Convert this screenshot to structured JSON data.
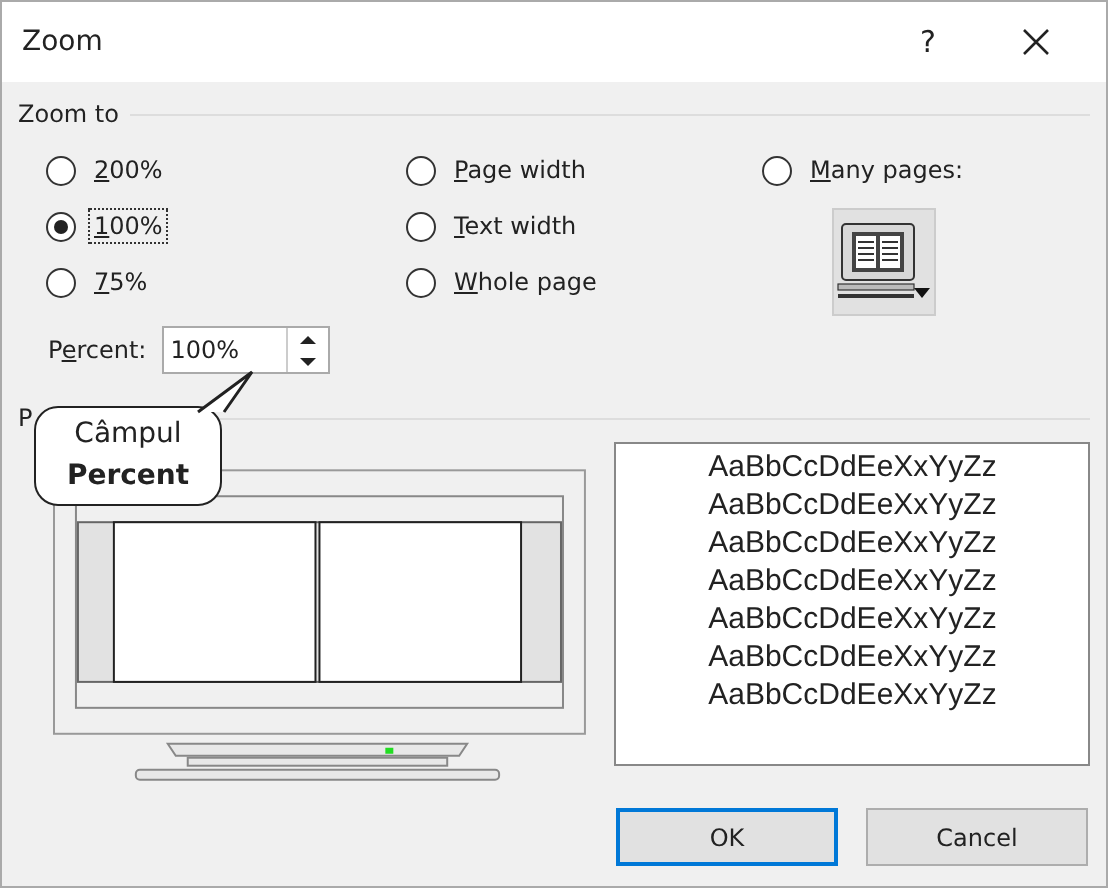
{
  "window": {
    "title": "Zoom",
    "help": "?"
  },
  "zoom_to": {
    "label": "Zoom to",
    "options": [
      {
        "key": "2",
        "post": "00%",
        "selected": false,
        "focused": false
      },
      {
        "key": "P",
        "post": "age width",
        "selected": false,
        "focused": false
      },
      {
        "key": "M",
        "post": "any pages:",
        "selected": false,
        "focused": false
      },
      {
        "key": "1",
        "post": "00%",
        "selected": true,
        "focused": true
      },
      {
        "key": "T",
        "post": "ext width",
        "selected": false,
        "focused": false
      },
      {
        "key": "7",
        "post": "5%",
        "selected": false,
        "focused": false
      },
      {
        "key": "W",
        "post": "hole page",
        "selected": false,
        "focused": false
      }
    ],
    "percent": {
      "pre": "P",
      "key": "e",
      "post": "rcent:",
      "value": "100%"
    }
  },
  "preview": {
    "label": "P",
    "samples": [
      "AaBbCcDdEeXxYyZz",
      "AaBbCcDdEeXxYyZz",
      "AaBbCcDdEeXxYyZz",
      "AaBbCcDdEeXxYyZz",
      "AaBbCcDdEeXxYyZz",
      "AaBbCcDdEeXxYyZz",
      "AaBbCcDdEeXxYyZz"
    ]
  },
  "callout": {
    "text": "Câmpul **Percent**"
  },
  "buttons": [
    {
      "label": "OK",
      "default": true
    },
    {
      "label": "Cancel",
      "default": false
    }
  ]
}
